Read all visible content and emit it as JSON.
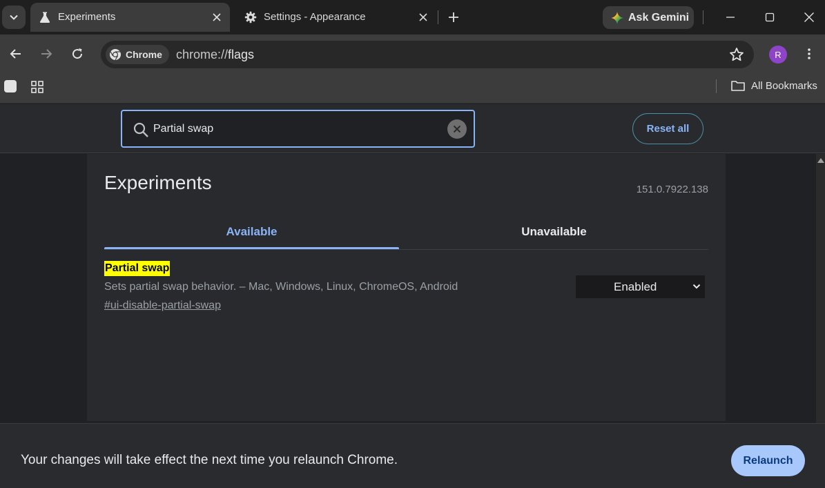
{
  "tab_strip": {
    "tabs": [
      {
        "title": "Experiments",
        "icon": "flask-icon",
        "active": true
      },
      {
        "title": "Settings - Appearance",
        "icon": "gear-icon",
        "active": false
      }
    ],
    "gemini_label": "Ask Gemini"
  },
  "toolbar": {
    "chip_label": "Chrome",
    "url_scheme": "chrome://",
    "url_path": "flags",
    "avatar_initial": "R"
  },
  "bookmarks": {
    "all_label": "All Bookmarks"
  },
  "flags_header": {
    "search_value": "Partial swap",
    "reset_label": "Reset all"
  },
  "page": {
    "title": "Experiments",
    "version": "151.0.7922.138",
    "tabs": [
      "Available",
      "Unavailable"
    ]
  },
  "flag": {
    "name": "Partial swap",
    "description": "Sets partial swap behavior. – Mac, Windows, Linux, ChromeOS, Android",
    "link": "#ui-disable-partial-swap",
    "state": "Enabled"
  },
  "relaunch": {
    "message": "Your changes will take effect the next time you relaunch Chrome.",
    "button_label": "Relaunch"
  },
  "colors": {
    "accent": "#8ab4f8",
    "highlight": "#ffff00",
    "relaunch_button": "#a8c7fa",
    "avatar": "#8e44c7"
  }
}
